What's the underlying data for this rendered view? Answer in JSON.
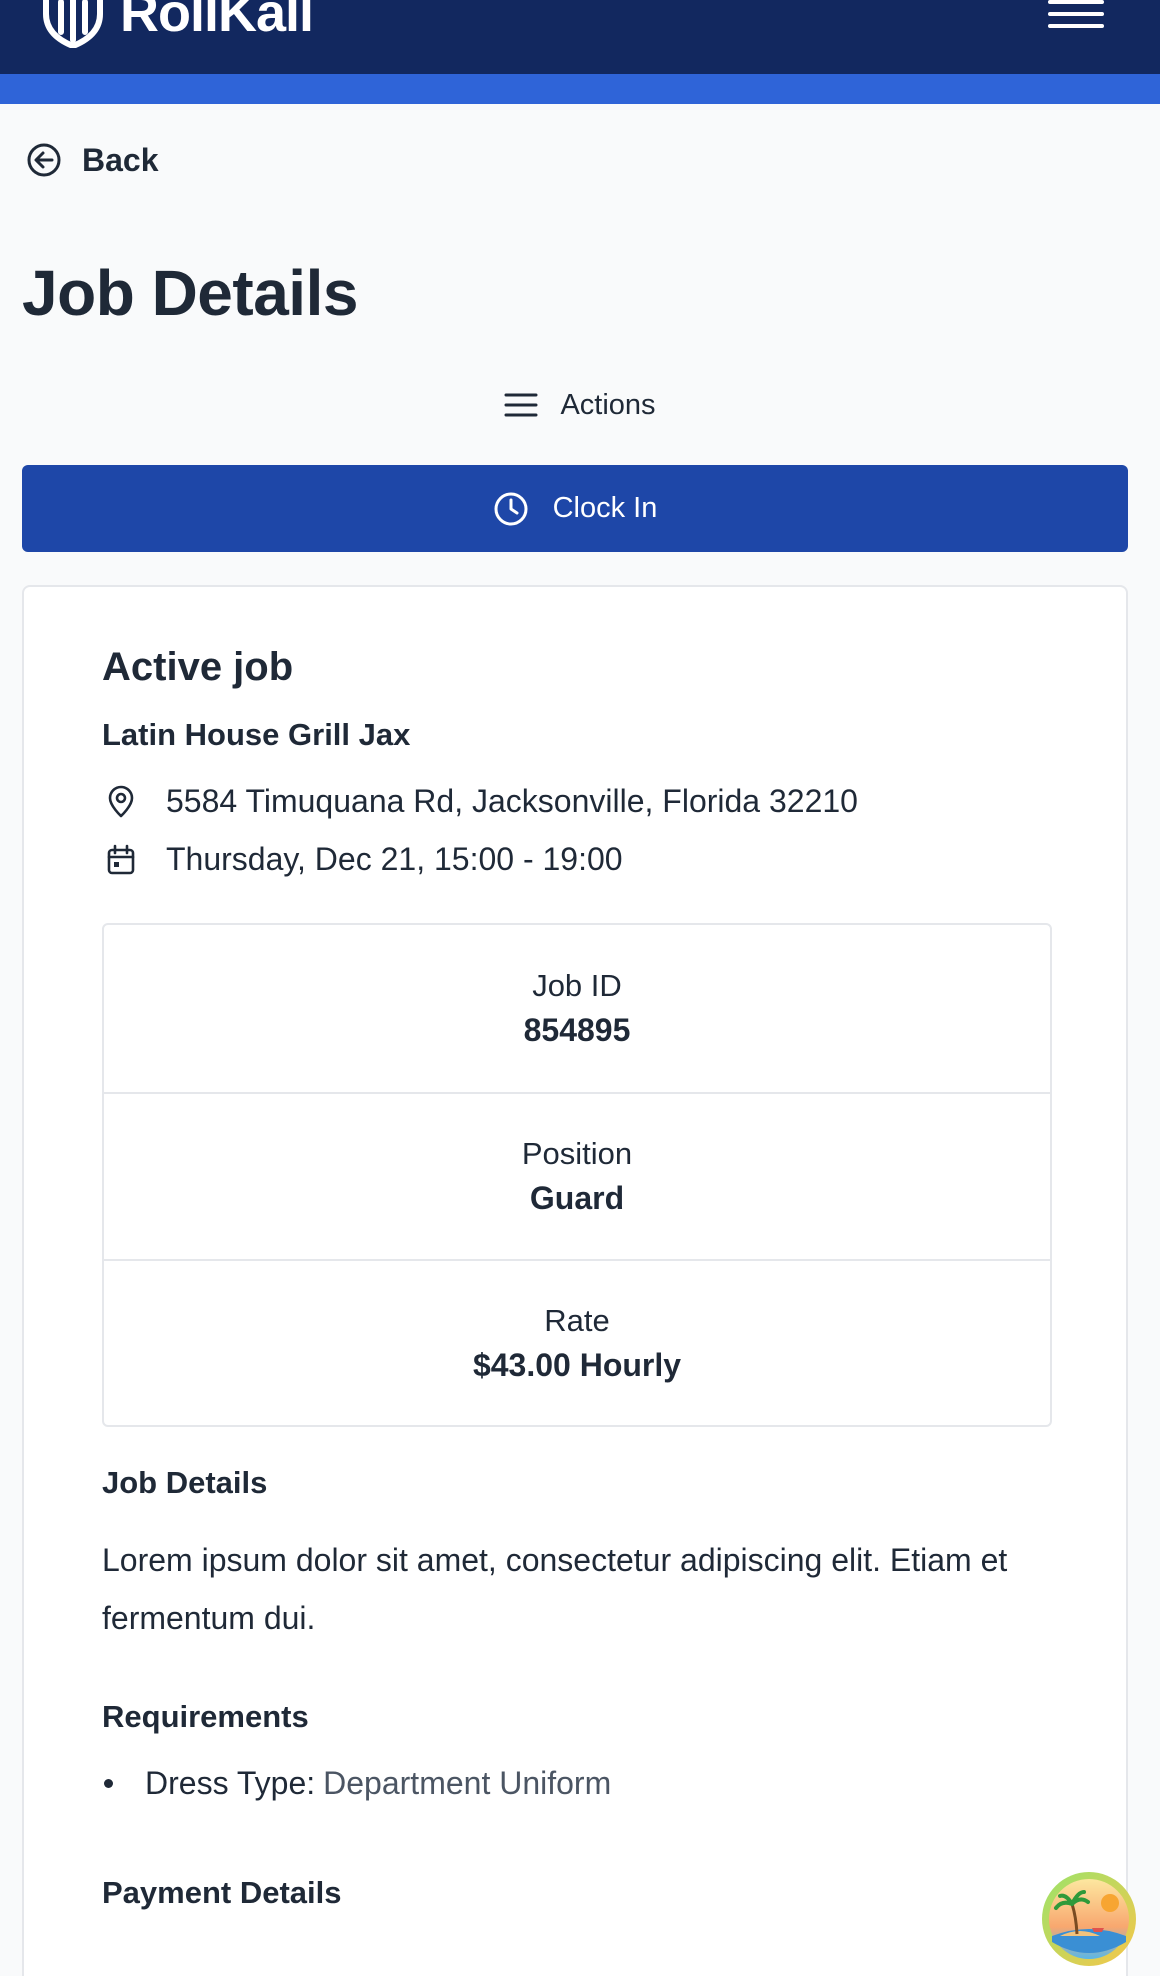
{
  "header": {
    "brand_name": "RollKall",
    "menu_icon": "hamburger-icon",
    "colors": {
      "bar": "#12285f",
      "stripe": "#2f64d8"
    }
  },
  "nav": {
    "back_label": "Back",
    "back_icon": "arrow-left-circle-icon"
  },
  "page": {
    "title": "Job Details",
    "actions_label": "Actions",
    "actions_icon": "menu-lines-icon",
    "clock_in_label": "Clock In",
    "clock_in_icon": "clock-icon",
    "primary_color": "#1e47a8"
  },
  "job": {
    "status_title": "Active job",
    "venue": "Latin House Grill Jax",
    "address": "5584 Timuquana Rd, Jacksonville, Florida 32210",
    "address_icon": "map-pin-icon",
    "schedule": "Thursday, Dec 21, 15:00 - 19:00",
    "schedule_icon": "calendar-icon",
    "stats": [
      {
        "label": "Job ID",
        "value": "854895"
      },
      {
        "label": "Position",
        "value": "Guard"
      },
      {
        "label": "Rate",
        "value": "$43.00 Hourly"
      }
    ],
    "details_heading": "Job Details",
    "description": "Lorem ipsum dolor sit amet, consectetur adipiscing elit. Etiam et fermentum dui.",
    "requirements_heading": "Requirements",
    "requirements": [
      {
        "label": "Dress Type:",
        "value": "Department Uniform"
      }
    ],
    "payment_heading": "Payment Details"
  },
  "floating_badge": {
    "icon": "beach-island-icon"
  }
}
